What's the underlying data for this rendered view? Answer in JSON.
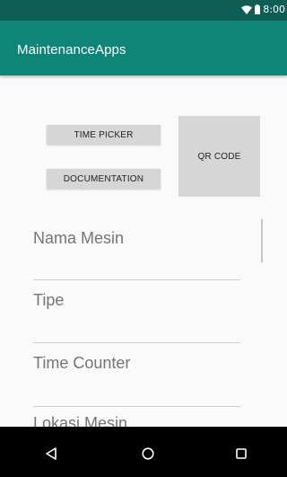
{
  "status_bar": {
    "time": "8:00",
    "icons": [
      "wifi-icon",
      "battery-icon"
    ]
  },
  "app_bar": {
    "title": "MaintenanceApps",
    "color": "#0f8577",
    "status_color": "#0e5e56"
  },
  "buttons": {
    "time_picker": "TIME PICKER",
    "documentation": "DOCUMENTATION",
    "qr_code": "QR CODE"
  },
  "form": {
    "fields": [
      {
        "label": "Nama Mesin"
      },
      {
        "label": "Tipe"
      },
      {
        "label": "Time Counter"
      },
      {
        "label": "Lokasi Mesin"
      }
    ]
  },
  "nav_bar": {
    "icons": [
      "back-icon",
      "home-icon",
      "recents-icon"
    ]
  }
}
